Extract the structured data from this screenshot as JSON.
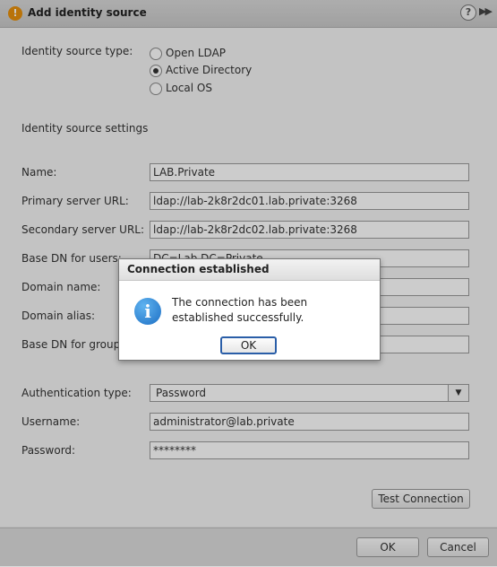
{
  "dialog": {
    "title": "Add identity source",
    "help_icon": "?",
    "expand_icon": "▶▶"
  },
  "form": {
    "identity_source_type_label": "Identity source type:",
    "options": [
      {
        "label": "Open LDAP",
        "checked": false
      },
      {
        "label": "Active Directory",
        "checked": true
      },
      {
        "label": "Local OS",
        "checked": false
      }
    ],
    "settings_heading": "Identity source settings",
    "name_label": "Name:",
    "name_value": "LAB.Private",
    "primary_url_label": "Primary server URL:",
    "primary_url_value": "ldap://lab-2k8r2dc01.lab.private:3268",
    "secondary_url_label": "Secondary server URL:",
    "secondary_url_value": "ldap://lab-2k8r2dc02.lab.private:3268",
    "base_dn_users_label": "Base DN for users:",
    "base_dn_users_value": "DC=Lab,DC=Private",
    "domain_name_label": "Domain name:",
    "domain_name_value": "",
    "domain_alias_label": "Domain alias:",
    "domain_alias_value": "",
    "base_dn_groups_label": "Base DN for groups:",
    "base_dn_groups_value": "",
    "auth_type_label": "Authentication type:",
    "auth_type_value": "Password",
    "username_label": "Username:",
    "username_value": "administrator@lab.private",
    "password_label": "Password:",
    "password_value": "********",
    "test_connection_label": "Test Connection"
  },
  "footer": {
    "ok_label": "OK",
    "cancel_label": "Cancel"
  },
  "modal": {
    "title": "Connection established",
    "message": "The connection has been established successfully.",
    "ok_label": "OK",
    "icon": "i"
  },
  "colors": {
    "warning_accent": "#e8900c",
    "info_accent": "#1d6fc4",
    "focus_border": "#2a5ea8"
  }
}
